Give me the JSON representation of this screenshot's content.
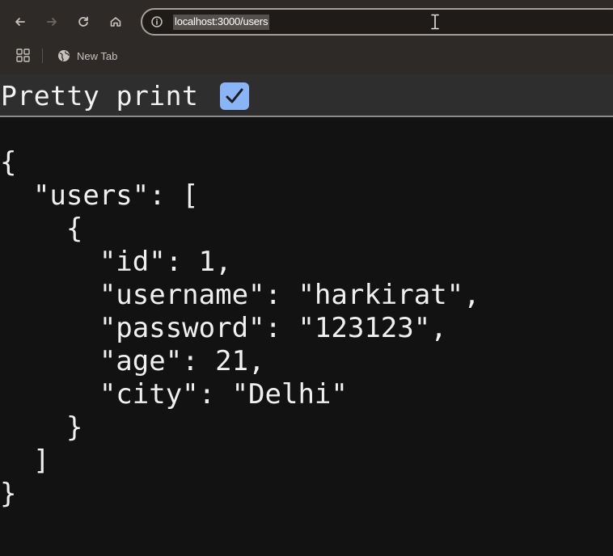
{
  "browser": {
    "url": "localhost:3000/users",
    "nav": {
      "back_icon": "arrow-left-icon",
      "forward_icon": "arrow-right-icon",
      "reload_icon": "reload-icon",
      "home_icon": "home-icon",
      "site_info_icon": "info-icon"
    },
    "bookmarks": {
      "apps_icon": "apps-grid-icon",
      "items": [
        {
          "label": "New Tab",
          "icon": "globe-icon"
        }
      ]
    }
  },
  "viewer": {
    "pretty_print_label": "Pretty print",
    "pretty_print_checked": true,
    "lines": [
      "{",
      "  \"users\": [",
      "    {",
      "      \"id\": 1,",
      "      \"username\": \"harkirat\",",
      "      \"password\": \"123123\",",
      "      \"age\": 21,",
      "      \"city\": \"Delhi\"",
      "    }",
      "  ]",
      "}"
    ]
  },
  "colors": {
    "chrome_bg": "#2e2a27",
    "viewer_bg": "#121212",
    "checkbox_accent": "#8ab4f8",
    "text": "#f0f0f0"
  }
}
